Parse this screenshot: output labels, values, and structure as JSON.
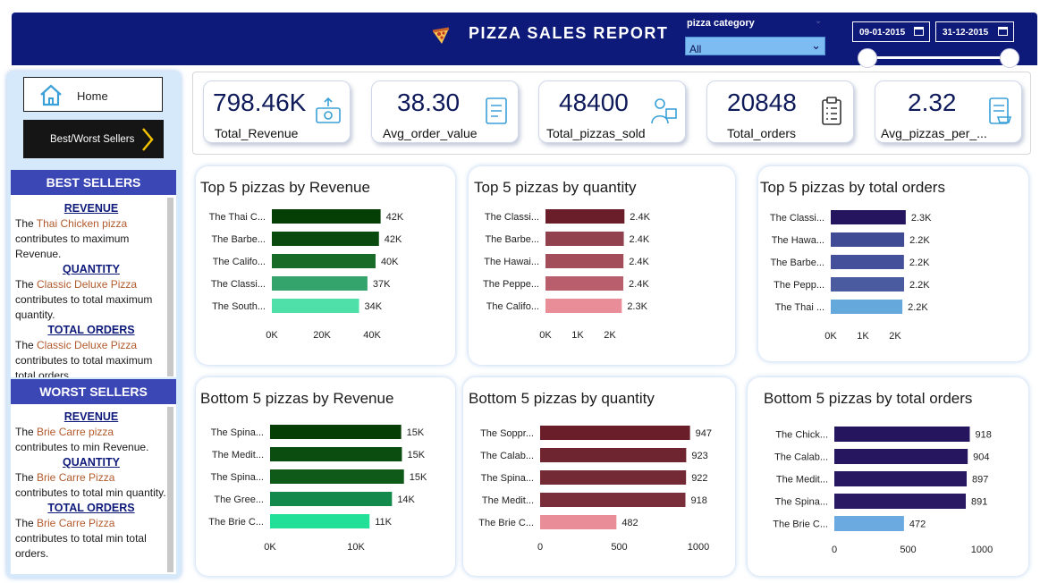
{
  "header": {
    "title": "PIZZA SALES REPORT",
    "slicer_label": "pizza category",
    "slicer_value": "All",
    "date_start": "09-01-2015",
    "date_end": "31-12-2015"
  },
  "sidebar": {
    "home_label": "Home",
    "nav_label": "Best/Worst Sellers",
    "best": {
      "heading": "BEST SELLERS",
      "rev_title": "REVENUE",
      "rev_pre": "The ",
      "rev_pizza": "Thai Chicken pizza",
      "rev_post": " contributes to maximum Revenue.",
      "qty_title": "QUANTITY",
      "qty_pre": "The ",
      "qty_pizza": "Classic Deluxe Pizza",
      "qty_post": " contributes to total maximum quantity.",
      "ord_title": "TOTAL ORDERS",
      "ord_pre": "The ",
      "ord_pizza": "Classic Deluxe Pizza",
      "ord_post": " contributes to total maximum total orders."
    },
    "worst": {
      "heading": "WORST SELLERS",
      "rev_title": "REVENUE",
      "rev_pre": "The ",
      "rev_pizza": "Brie Carre pizza",
      "rev_post": " contributes to min Revenue.",
      "qty_title": "QUANTITY",
      "qty_pre": "The ",
      "qty_pizza": "Brie Carre Pizza",
      "qty_post": " contributes to total min quantity.",
      "ord_title": "TOTAL ORDERS",
      "ord_pre": "The ",
      "ord_pizza": "Brie Carre Pizza",
      "ord_post": " contributes to total min total orders."
    }
  },
  "kpis": [
    {
      "value": "798.46K",
      "label": "Total_Revenue",
      "icon": "money-icon"
    },
    {
      "value": "38.30",
      "label": "Avg_order_value",
      "icon": "order-list-icon"
    },
    {
      "value": "48400",
      "label": "Total_pizzas_sold",
      "icon": "delivery-person-icon"
    },
    {
      "value": "20848",
      "label": "Total_orders",
      "icon": "clipboard-icon"
    },
    {
      "value": "2.32",
      "label": "Avg_pizzas_per_...",
      "icon": "cart-list-icon"
    }
  ],
  "chart_data": [
    {
      "type": "bar",
      "orientation": "horizontal",
      "title": "Top 5 pizzas by Revenue",
      "categories": [
        "The Thai C...",
        "The Barbe...",
        "The Califo...",
        "The Classi...",
        "The South..."
      ],
      "values": [
        43434,
        42768,
        41410,
        38180,
        34831
      ],
      "data_labels": [
        "42K",
        "42K",
        "40K",
        "37K",
        "34K"
      ],
      "xticks": [
        "0K",
        "20K",
        "40K"
      ],
      "xlim": [
        0,
        40000
      ],
      "colors": [
        "#063f06",
        "#0a4a0f",
        "#176b27",
        "#35a46c",
        "#4ee0a8"
      ]
    },
    {
      "type": "bar",
      "orientation": "horizontal",
      "title": "Top 5 pizzas by quantity",
      "categories": [
        "The Classi...",
        "The Barbe...",
        "The Hawai...",
        "The Peppe...",
        "The Califo..."
      ],
      "values": [
        2453,
        2432,
        2422,
        2418,
        2370
      ],
      "data_labels": [
        "2.4K",
        "2.4K",
        "2.4K",
        "2.4K",
        "2.3K"
      ],
      "xticks": [
        "0K",
        "1K",
        "2K"
      ],
      "xlim": [
        0,
        2000
      ],
      "colors": [
        "#6a1e2a",
        "#90414d",
        "#a34c5a",
        "#b85e6c",
        "#e98e99"
      ]
    },
    {
      "type": "bar",
      "orientation": "horizontal",
      "title": "Top 5 pizzas by total orders",
      "categories": [
        "The Classi...",
        "The Hawa...",
        "The Barbe...",
        "The Pepp...",
        "The Thai ..."
      ],
      "values": [
        2329,
        2280,
        2273,
        2278,
        2225
      ],
      "data_labels": [
        "2.3K",
        "2.2K",
        "2.2K",
        "2.2K",
        "2.2K"
      ],
      "xticks": [
        "0K",
        "1K",
        "2K"
      ],
      "xlim": [
        0,
        2000
      ],
      "colors": [
        "#25155e",
        "#3f4c95",
        "#44519a",
        "#4a5ba0",
        "#64a8dc"
      ]
    },
    {
      "type": "bar",
      "orientation": "horizontal",
      "title": "Bottom 5 pizzas by Revenue",
      "categories": [
        "The Spina...",
        "The Medit...",
        "The Spina...",
        "The Gree...",
        "The Brie C..."
      ],
      "values": [
        15277,
        15360,
        15596,
        14200,
        11588
      ],
      "data_labels": [
        "15K",
        "15K",
        "15K",
        "14K",
        "11K"
      ],
      "xticks": [
        "0K",
        "10K"
      ],
      "xlim": [
        0,
        10000
      ],
      "colors": [
        "#063f06",
        "#0b4d10",
        "#0f5a18",
        "#138a4b",
        "#22e098"
      ]
    },
    {
      "type": "bar",
      "orientation": "horizontal",
      "title": "Bottom 5 pizzas by quantity",
      "categories": [
        "The Soppr...",
        "The Calab...",
        "The Spina...",
        "The Medit...",
        "The Brie C..."
      ],
      "values": [
        947,
        923,
        922,
        918,
        482
      ],
      "data_labels": [
        "947",
        "923",
        "922",
        "918",
        "482"
      ],
      "xticks": [
        "0",
        "500",
        "1000"
      ],
      "xlim": [
        0,
        1000
      ],
      "colors": [
        "#6a1e2a",
        "#6f2530",
        "#742a34",
        "#7a2e39",
        "#e98e99"
      ]
    },
    {
      "type": "bar",
      "orientation": "horizontal",
      "title": "Bottom 5 pizzas by total orders",
      "categories": [
        "The Chick...",
        "The Calab...",
        "The Medit...",
        "The Spina...",
        "The Brie C..."
      ],
      "values": [
        918,
        904,
        897,
        891,
        472
      ],
      "data_labels": [
        "918",
        "904",
        "897",
        "891",
        "472"
      ],
      "xticks": [
        "0",
        "500",
        "1000"
      ],
      "xlim": [
        0,
        1000
      ],
      "colors": [
        "#25155e",
        "#26165f",
        "#281862",
        "#2a1a64",
        "#6aaae0"
      ]
    }
  ]
}
